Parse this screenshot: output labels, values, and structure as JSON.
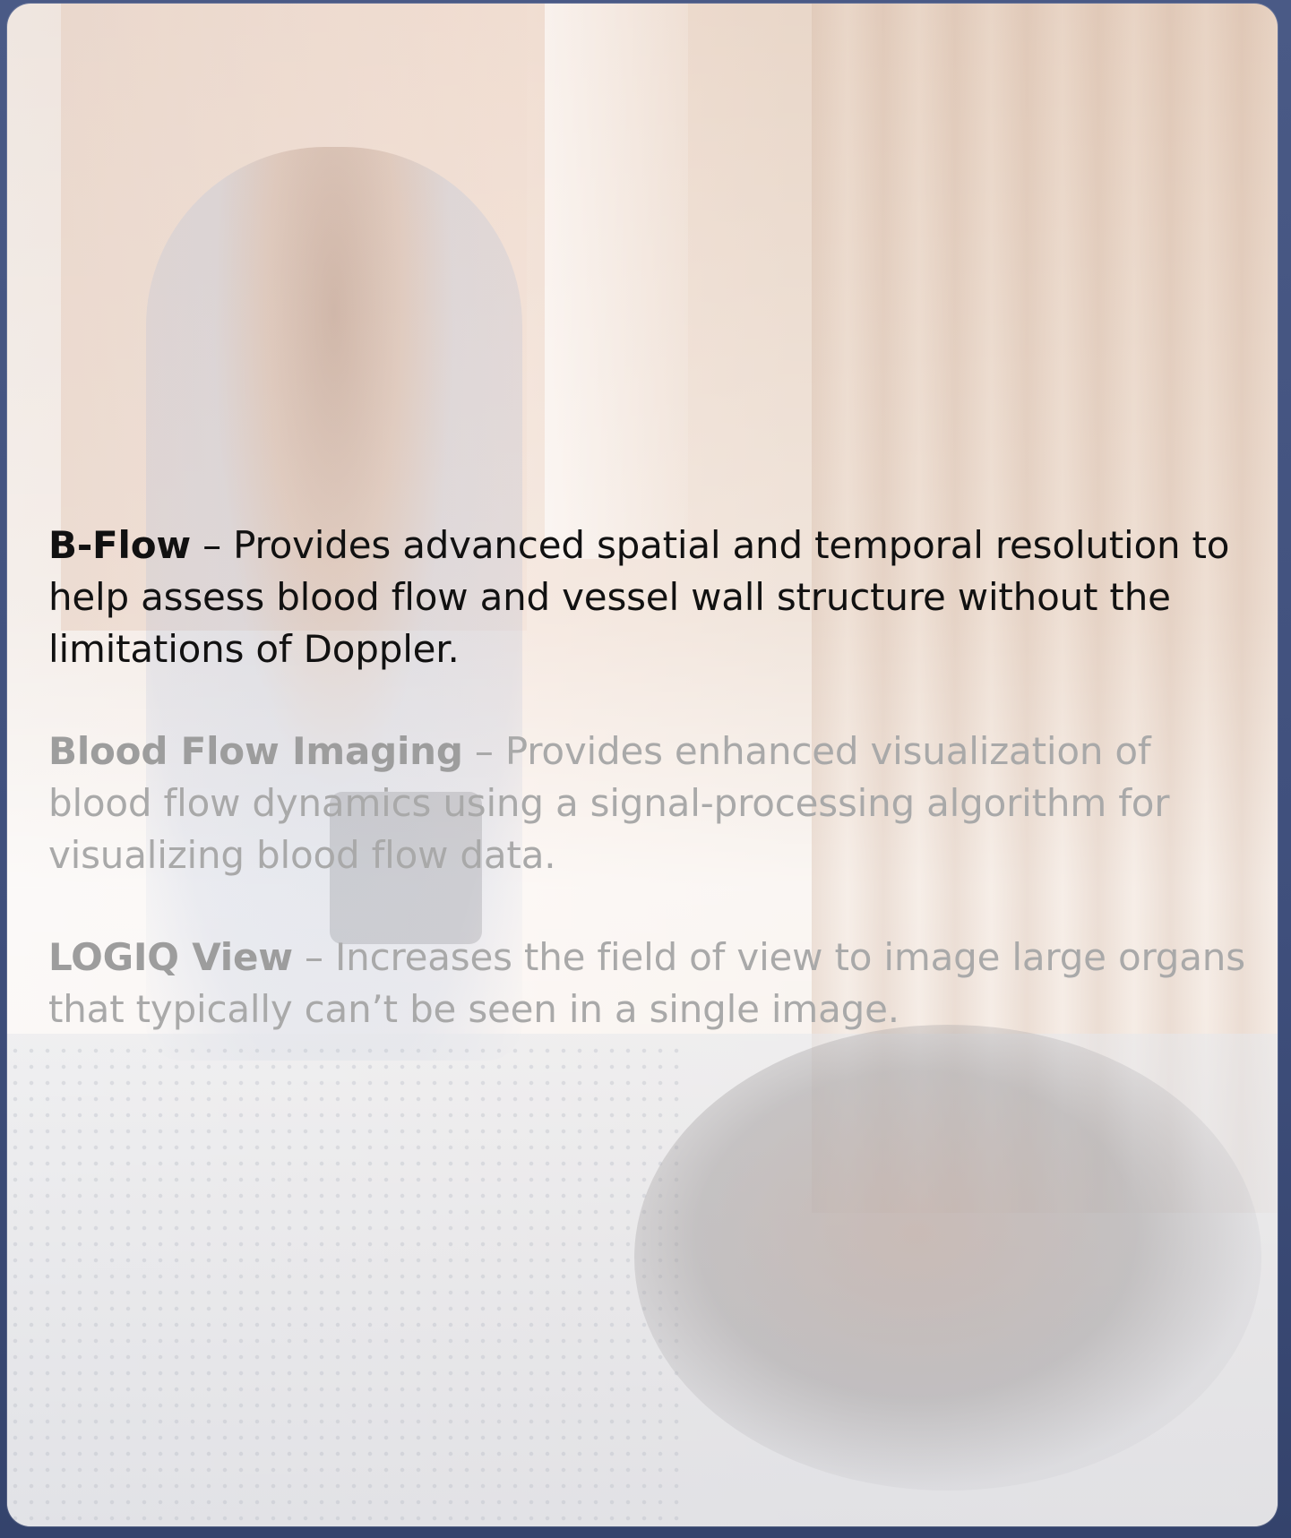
{
  "features": [
    {
      "term": "B-Flow",
      "description": " – Provides advanced spatial and temporal resolution to help assess blood flow and vessel wall structure without the limitations of Doppler."
    },
    {
      "term": "Blood Flow Imaging",
      "description": " – Provides enhanced visualization of blood flow dynamics using a signal-processing algorithm for visualizing blood flow data."
    },
    {
      "term": "LOGIQ View",
      "description": " – Increases the field of view to image large organs that typically can’t be seen in a single image."
    }
  ]
}
